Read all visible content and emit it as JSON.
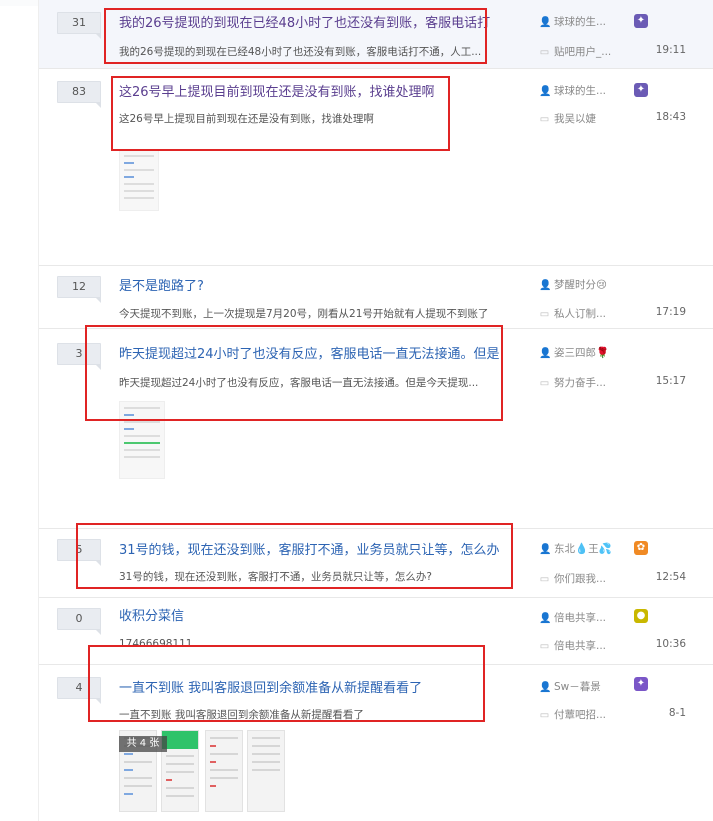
{
  "threads": [
    {
      "reply_count": "31",
      "title": "我的26号提现的到现在已经48小时了也还没有到账，客服电话打",
      "abstract": "我的26号提现的到现在已经48小时了也还没有到账，客服电话打不通，人工...",
      "author": "球球的生...",
      "last_reply_user": "贴吧用户_...",
      "time": "19:11"
    },
    {
      "reply_count": "83",
      "title": "这26号早上提现目前到现在还是没有到账，找谁处理啊",
      "abstract": "这26号早上提现目前到现在还是没有到账，找谁处理啊",
      "author": "球球的生...",
      "last_reply_user": "我吴以婕",
      "time": "18:43"
    },
    {
      "reply_count": "12",
      "title": "是不是跑路了?",
      "abstract": "今天提现不到账，上一次提现是7月20号，刚看从21号开始就有人提现不到账了",
      "author": "梦醒时分😢",
      "last_reply_user": "私人订制...",
      "time": "17:19"
    },
    {
      "reply_count": "3",
      "title": "昨天提现超过24小时了也没有反应，客服电话一直无法接通。但是",
      "abstract": "昨天提现超过24小时了也没有反应，客服电话一直无法接通。但是今天提现...",
      "author": "姿三四郎🌹",
      "last_reply_user": "努力奋手...",
      "time": "15:17"
    },
    {
      "reply_count": "5",
      "title": "31号的钱，现在还没到账，客服打不通，业务员就只让等，怎么办",
      "abstract": "31号的钱，现在还没到账，客服打不通，业务员就只让等，怎么办?",
      "author": "东北💧王💦",
      "last_reply_user": "你们跟我...",
      "time": "12:54"
    },
    {
      "reply_count": "0",
      "title": "收积分菜信",
      "abstract": "17466698111",
      "author": "倍电共享...",
      "last_reply_user": "倍电共享...",
      "time": "10:36"
    },
    {
      "reply_count": "4",
      "title": "一直不到账 我叫客服退回到余额准备从新提醒看看了",
      "abstract": "一直不到账 我叫客服退回到余额准备从新提醒看看了",
      "author": "Sw－暮景",
      "last_reply_user": "付蕈吧招...",
      "time": "8-1",
      "image_count_label": "共 4 张"
    }
  ],
  "colors": {
    "link": "#2d64b3",
    "visited": "#5a3e8f",
    "highlight_box": "#e02424"
  },
  "icons": {
    "author": "person-icon",
    "last_reply": "chat-icon"
  }
}
